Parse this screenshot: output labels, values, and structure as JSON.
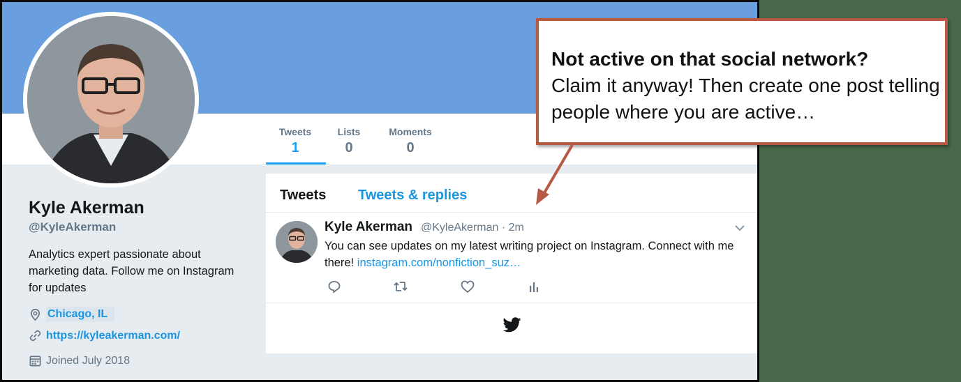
{
  "profile": {
    "name": "Kyle Akerman",
    "handle": "@KyleAkerman",
    "bio": "Analytics expert passionate about marketing data. Follow me on Instagram for updates",
    "location": "Chicago, IL",
    "website": "https://kyleakerman.com/",
    "joined": "Joined July 2018"
  },
  "stats": [
    {
      "label": "Tweets",
      "value": "1",
      "active": true
    },
    {
      "label": "Lists",
      "value": "0",
      "active": false
    },
    {
      "label": "Moments",
      "value": "0",
      "active": false
    }
  ],
  "timeline": {
    "tabs": [
      {
        "label": "Tweets",
        "active": true
      },
      {
        "label": "Tweets & replies",
        "active": false
      }
    ],
    "tweet": {
      "author": "Kyle Akerman",
      "meta": "@KyleAkerman · 2m",
      "text": "You can see updates on my latest writing project on Instagram. Connect with me there! ",
      "link": "instagram.com/nonfiction_suz…"
    },
    "action_icons": [
      "reply-icon",
      "retweet-icon",
      "like-icon",
      "analytics-icon"
    ]
  },
  "callout": {
    "heading": "Not active on that social network?",
    "body": "Claim it anyway! Then create one post telling people where you are active…"
  },
  "colors": {
    "banner": "#6a9fdf",
    "accent": "#1da1f2",
    "link": "#1b95e0",
    "callout_border": "#b65a43",
    "outer_background": "#48684a"
  }
}
